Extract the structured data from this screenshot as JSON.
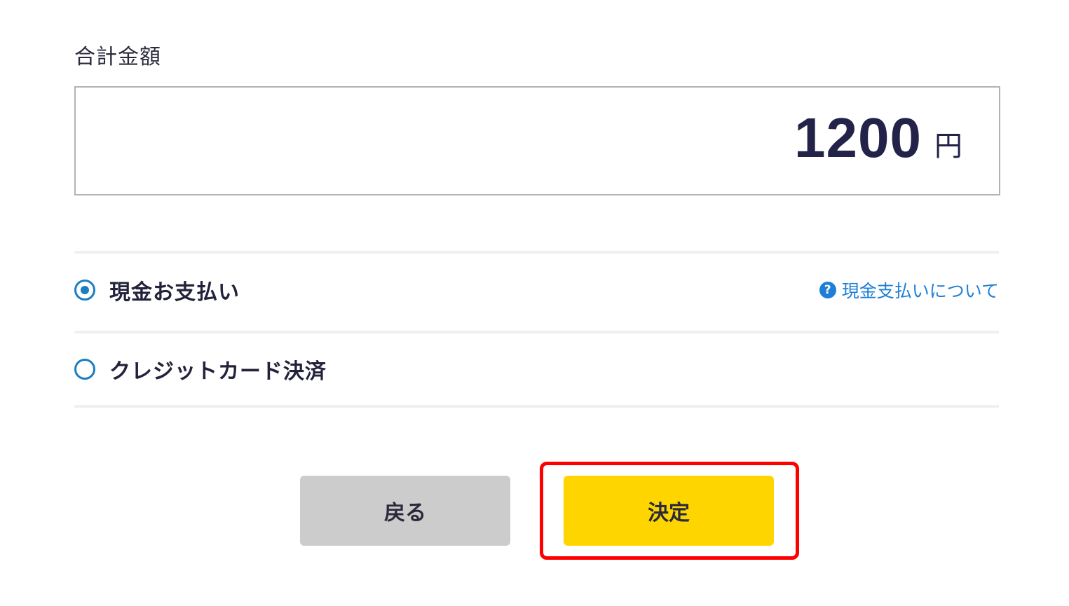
{
  "total": {
    "label": "合計金額",
    "amount": "1200",
    "currency": "円"
  },
  "payment": {
    "options": [
      {
        "label": "現金お支払い",
        "selected": true
      },
      {
        "label": "クレジットカード決済",
        "selected": false
      }
    ],
    "help_link": "現金支払いについて",
    "help_icon": "question-circle-icon"
  },
  "actions": {
    "back_label": "戻る",
    "confirm_label": "決定"
  },
  "colors": {
    "accent_blue": "#1a7ec4",
    "link_blue": "#1f7fd6",
    "confirm_yellow": "#ffd500",
    "back_gray": "#cccccc",
    "highlight_red": "#ff0000",
    "text_dark": "#23234a"
  }
}
